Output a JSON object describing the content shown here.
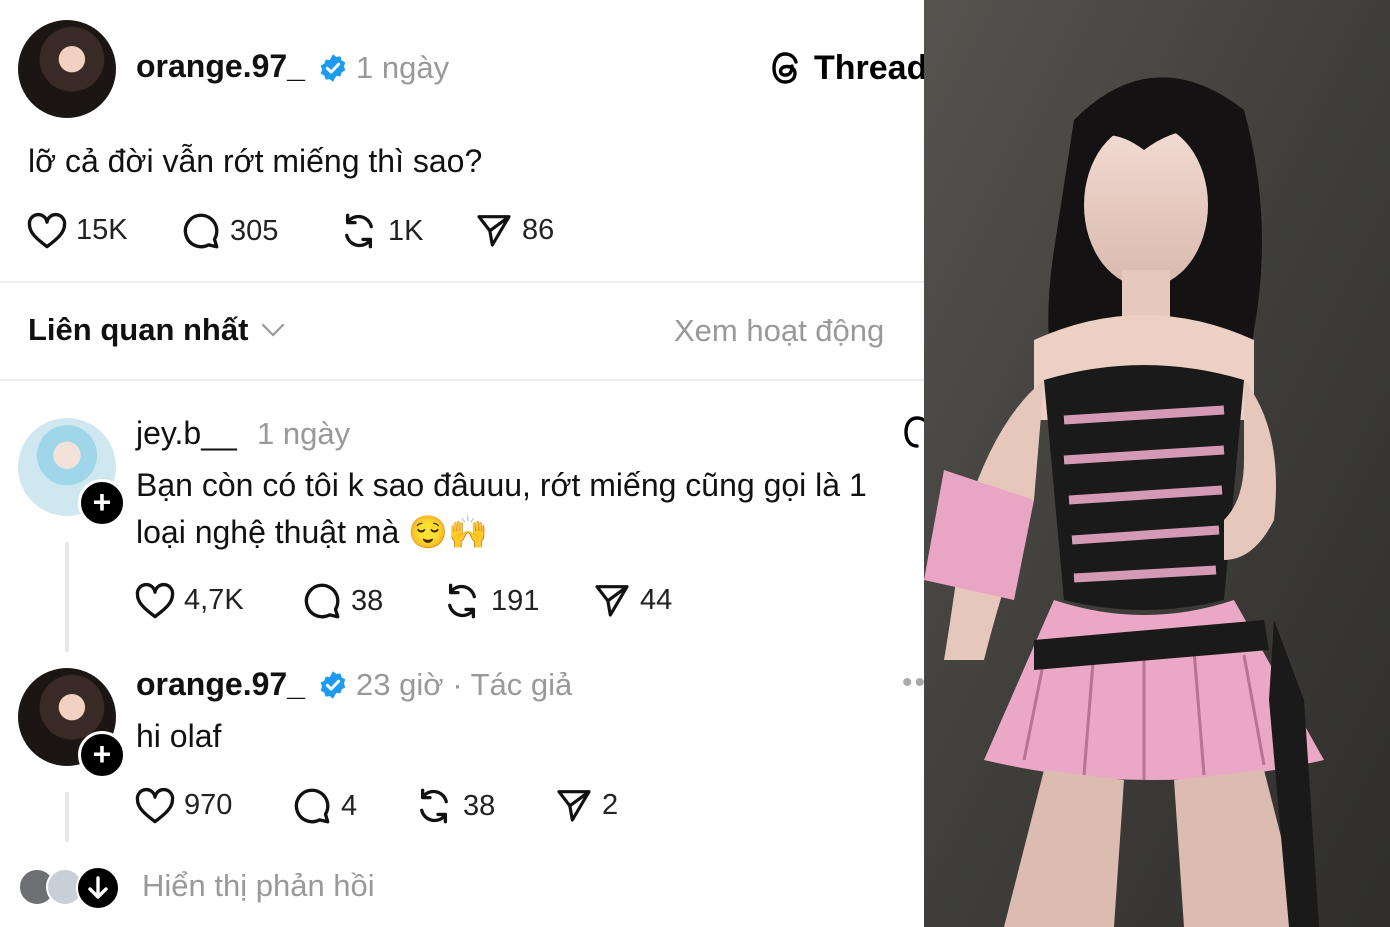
{
  "post": {
    "username": "orange.97_",
    "time": "1 ngày",
    "brand": "Thread",
    "text": "lỡ cả đời vẫn rớt miếng thì sao?",
    "stats": {
      "likes": "15K",
      "comments": "305",
      "reposts": "1K",
      "shares": "86"
    }
  },
  "filter": {
    "label": "Liên quan nhất",
    "activity": "Xem hoạt động"
  },
  "replies": [
    {
      "username": "jey.b__",
      "time": "1 ngày",
      "text_line1": "Bạn còn có tôi k sao đâuuu, rớt miếng cũng gọi là 1",
      "text_line2": "loại nghệ thuật mà 😌🙌",
      "stats": {
        "likes": "4,7K",
        "comments": "38",
        "reposts": "191",
        "shares": "44"
      }
    },
    {
      "username": "orange.97_",
      "time": "23 giờ",
      "separator": "·",
      "author_tag": "Tác giả",
      "text": "hi olaf",
      "stats": {
        "likes": "970",
        "comments": "4",
        "reposts": "38",
        "shares": "2"
      }
    }
  ],
  "show_replies": "Hiển thị phản hồi",
  "colors": {
    "verified": "#1d9bf0",
    "muted": "#999999",
    "divider": "#eeeeee"
  }
}
